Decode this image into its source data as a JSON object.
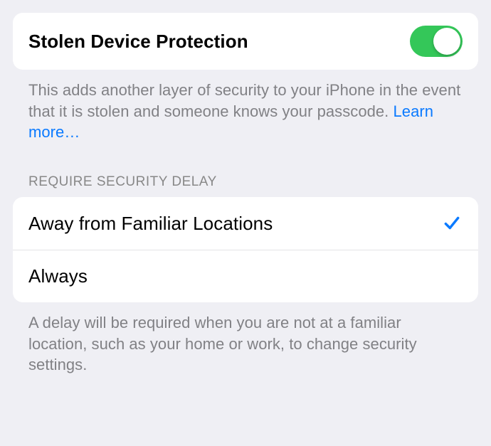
{
  "main": {
    "toggle_label": "Stolen Device Protection",
    "toggle_on": true,
    "description": "This adds another layer of security to your iPhone in the event that it is stolen and someone knows your passcode. ",
    "learn_more": "Learn more…"
  },
  "delay_section": {
    "header": "REQUIRE SECURITY DELAY",
    "options": [
      {
        "label": "Away from Familiar Locations",
        "selected": true
      },
      {
        "label": "Always",
        "selected": false
      }
    ],
    "footer": "A delay will be required when you are not at a familiar location, such as your home or work, to change security settings."
  },
  "colors": {
    "accent_green": "#34c759",
    "accent_blue": "#0a7aff"
  }
}
